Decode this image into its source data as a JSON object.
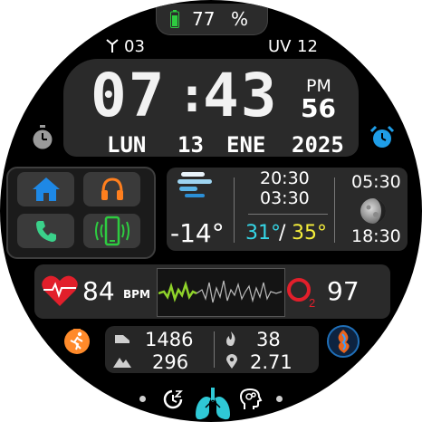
{
  "battery": {
    "value": "77",
    "unit": "%",
    "color": "#2ecc40"
  },
  "signal": {
    "value": "03"
  },
  "uv": {
    "label": "UV",
    "value": "12"
  },
  "time": {
    "hours": "07",
    "minutes": "43",
    "ampm": "PM",
    "seconds": "56"
  },
  "date": {
    "weekday": "LUN",
    "day": "13",
    "month": "ENE",
    "year": "2025"
  },
  "apps": [
    {
      "name": "home",
      "color": "#1e88e5"
    },
    {
      "name": "music",
      "color": "#ff7f1e"
    },
    {
      "name": "phone",
      "color": "#3ad18a"
    },
    {
      "name": "vibrate",
      "color": "#2ecc40"
    }
  ],
  "weather": {
    "icon": "fog-icon",
    "temp": "-14°",
    "time_1": "20:30",
    "time_2": "03:30",
    "temp_min": "31°",
    "temp_sep": "/",
    "temp_max": "35°",
    "min_color": "#35d6e6",
    "max_color": "#f5ee3b"
  },
  "moon": {
    "rise": "05:30",
    "set": "18:30"
  },
  "health": {
    "heart_rate": "84",
    "hr_unit": "BPM",
    "oxygen": "97",
    "heart_color": "#e21f2b",
    "ekg_color": "#8fd32a"
  },
  "activity": {
    "steps": "1486",
    "floors": "296",
    "calories": "38",
    "distance": "2.71"
  },
  "dock": {
    "center_color": "#2fc9d6"
  }
}
